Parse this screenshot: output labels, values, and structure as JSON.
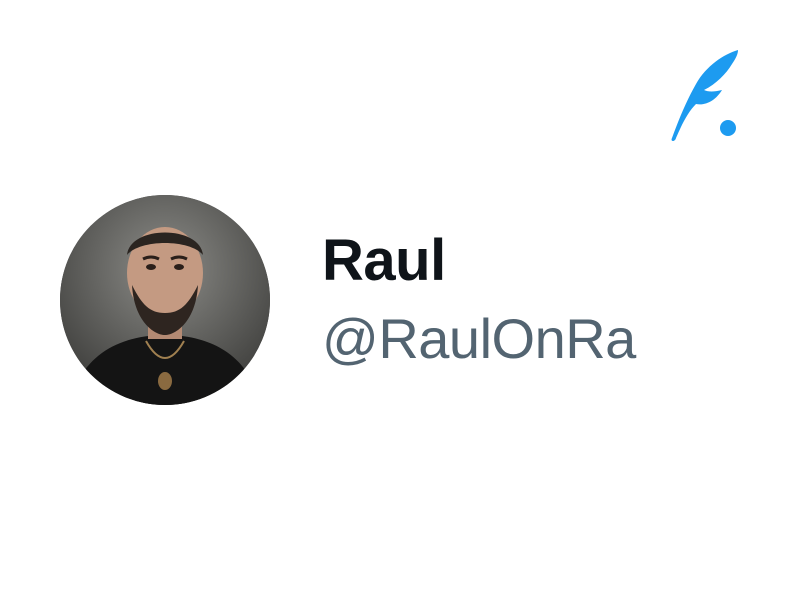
{
  "brand": {
    "logo_icon": "quill-feather-logo-icon",
    "accent_color": "#1d9bf0"
  },
  "profile": {
    "avatar_icon": "profile-photo",
    "display_name": "Raul",
    "handle": "@RaulOnRa",
    "name_color": "#0f1419",
    "handle_color": "#536471"
  }
}
